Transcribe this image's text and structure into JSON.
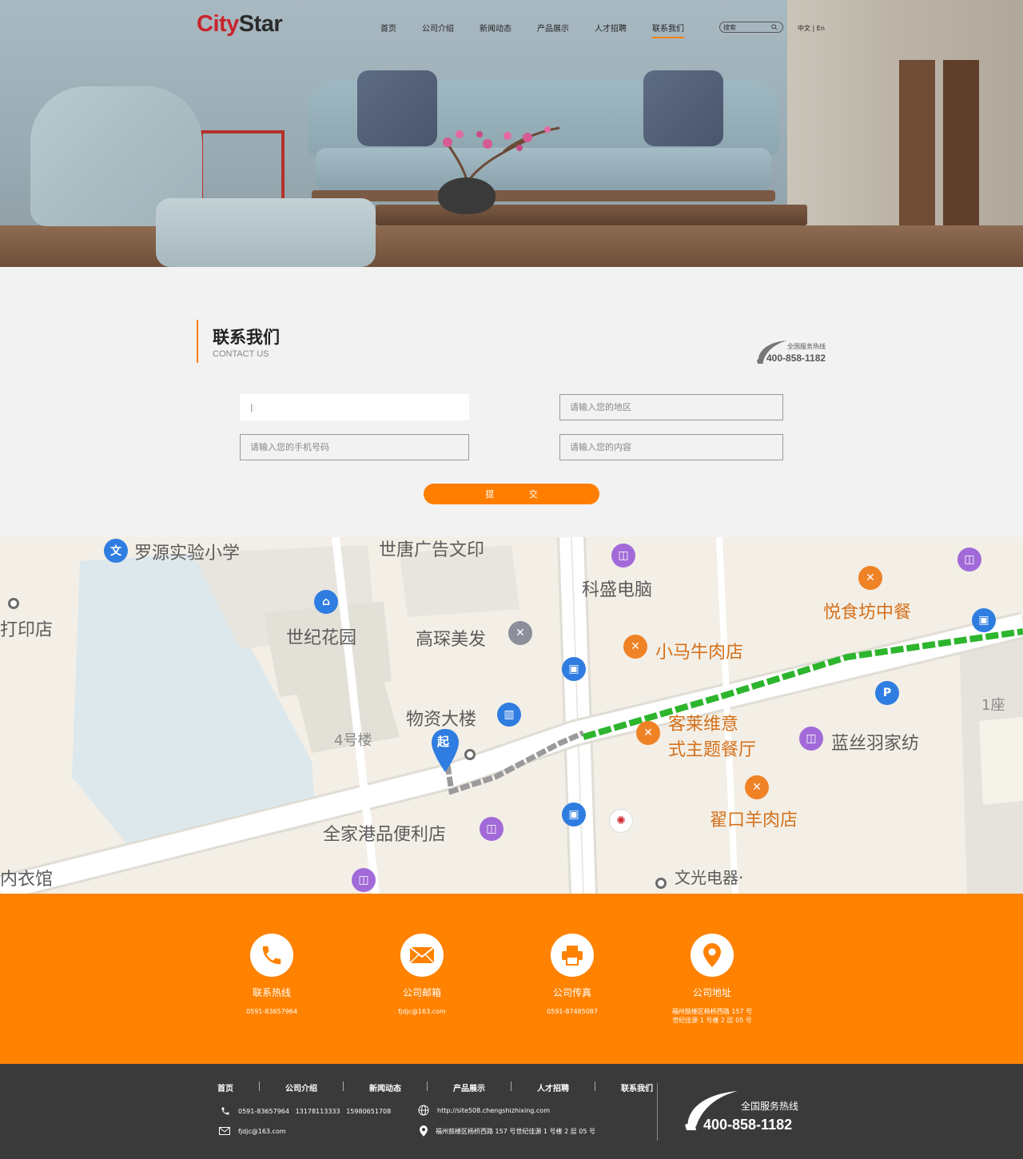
{
  "brand": {
    "part1": "City",
    "part2": "Star",
    "accent": "#ff7e00",
    "logo_red": "#c9232b"
  },
  "nav": {
    "items": [
      "首页",
      "公司介绍",
      "新闻动态",
      "产品展示",
      "人才招聘",
      "联系我们"
    ],
    "active": "联系我们",
    "search_placeholder": "搜索",
    "lang": "中文 | En"
  },
  "contact": {
    "title": "联系我们",
    "subtitle": "CONTACT US",
    "hotline_label": "全国服务热线",
    "hotline_number": "400-858-1182",
    "fields": {
      "name_value": "|",
      "region_placeholder": "请输入您的地区",
      "phone_placeholder": "请输入您的手机号码",
      "content_placeholder": "请输入您的内容"
    },
    "submit_label": "提 交"
  },
  "map": {
    "labels": [
      "罗源实验小学",
      "世唐广告文印",
      "科盛电脑",
      "悦食坊中餐",
      "打印店",
      "世纪花园",
      "高琛美发",
      "小马牛肉店",
      "物资大楼",
      "4号楼",
      "客莱维意",
      "式主题餐厅",
      "蓝丝羽家纺",
      "1座",
      "翟口羊肉店",
      "全家港品便利店",
      "内衣馆",
      "文光电器·"
    ],
    "start_marker": "起",
    "route_color": "#2db52d"
  },
  "info": [
    {
      "icon": "phone-icon",
      "title": "联系热线",
      "value": "0591-83657964"
    },
    {
      "icon": "mail-icon",
      "title": "公司邮箱",
      "value": "fjdjc@163.com"
    },
    {
      "icon": "printer-icon",
      "title": "公司传真",
      "value": "0591-87485087"
    },
    {
      "icon": "location-icon",
      "title": "公司地址",
      "value": "福州鼓楼区杨桥西路 157 号",
      "value2": "世纪佳源 1 号楼 2 层 05 号"
    }
  ],
  "footer": {
    "nav": [
      "首页",
      "公司介绍",
      "新闻动态",
      "产品展示",
      "人才招聘",
      "联系我们"
    ],
    "phones": "0591-83657964   13178113333   15980651708",
    "email": "fjdjc@163.com",
    "website": "http://site508.chengshizhixing.com",
    "address": "福州鼓楼区杨桥西路 157 号世纪佳源 1 号楼 2 层 05 号",
    "hotline_label": "全国服务热线",
    "hotline_number": "400-858-1182"
  }
}
